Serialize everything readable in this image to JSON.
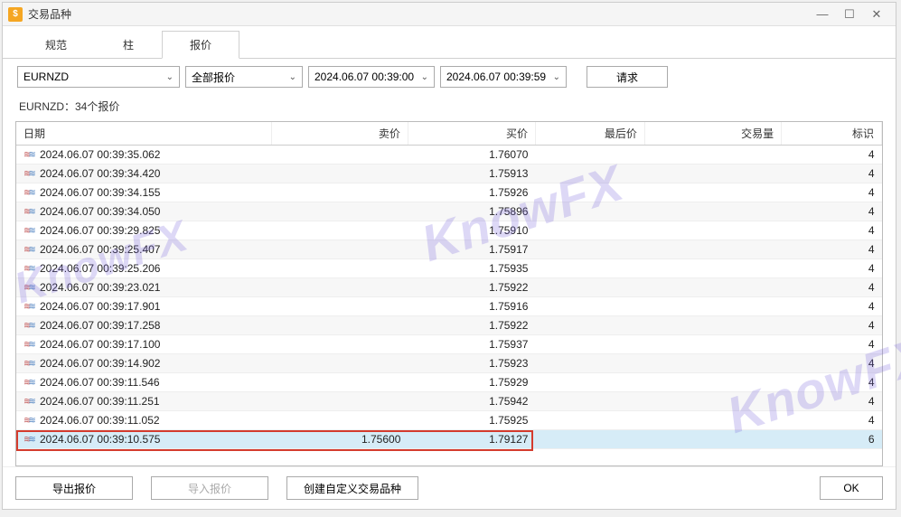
{
  "window": {
    "title": "交易品种",
    "icon_glyph": "$"
  },
  "tabs": [
    {
      "label": "规范",
      "active": false
    },
    {
      "label": "柱",
      "active": false
    },
    {
      "label": "报价",
      "active": true
    }
  ],
  "controls": {
    "symbol": "EURNZD",
    "price_type": "全部报价",
    "from": "2024.06.07 00:39:00",
    "to": "2024.06.07 00:39:59",
    "request_label": "请求"
  },
  "summary": "EURNZD：34个报价",
  "columns": {
    "date": "日期",
    "ask": "卖价",
    "bid": "买价",
    "last": "最后价",
    "volume": "交易量",
    "flag": "标识"
  },
  "rows": [
    {
      "date": "2024.06.07 00:39:35.062",
      "ask": "",
      "bid": "1.76070",
      "last": "",
      "volume": "",
      "flag": "4"
    },
    {
      "date": "2024.06.07 00:39:34.420",
      "ask": "",
      "bid": "1.75913",
      "last": "",
      "volume": "",
      "flag": "4"
    },
    {
      "date": "2024.06.07 00:39:34.155",
      "ask": "",
      "bid": "1.75926",
      "last": "",
      "volume": "",
      "flag": "4"
    },
    {
      "date": "2024.06.07 00:39:34.050",
      "ask": "",
      "bid": "1.75896",
      "last": "",
      "volume": "",
      "flag": "4"
    },
    {
      "date": "2024.06.07 00:39:29.825",
      "ask": "",
      "bid": "1.75910",
      "last": "",
      "volume": "",
      "flag": "4"
    },
    {
      "date": "2024.06.07 00:39:25.407",
      "ask": "",
      "bid": "1.75917",
      "last": "",
      "volume": "",
      "flag": "4"
    },
    {
      "date": "2024.06.07 00:39:25.206",
      "ask": "",
      "bid": "1.75935",
      "last": "",
      "volume": "",
      "flag": "4"
    },
    {
      "date": "2024.06.07 00:39:23.021",
      "ask": "",
      "bid": "1.75922",
      "last": "",
      "volume": "",
      "flag": "4"
    },
    {
      "date": "2024.06.07 00:39:17.901",
      "ask": "",
      "bid": "1.75916",
      "last": "",
      "volume": "",
      "flag": "4"
    },
    {
      "date": "2024.06.07 00:39:17.258",
      "ask": "",
      "bid": "1.75922",
      "last": "",
      "volume": "",
      "flag": "4"
    },
    {
      "date": "2024.06.07 00:39:17.100",
      "ask": "",
      "bid": "1.75937",
      "last": "",
      "volume": "",
      "flag": "4"
    },
    {
      "date": "2024.06.07 00:39:14.902",
      "ask": "",
      "bid": "1.75923",
      "last": "",
      "volume": "",
      "flag": "4"
    },
    {
      "date": "2024.06.07 00:39:11.546",
      "ask": "",
      "bid": "1.75929",
      "last": "",
      "volume": "",
      "flag": "4"
    },
    {
      "date": "2024.06.07 00:39:11.251",
      "ask": "",
      "bid": "1.75942",
      "last": "",
      "volume": "",
      "flag": "4"
    },
    {
      "date": "2024.06.07 00:39:11.052",
      "ask": "",
      "bid": "1.75925",
      "last": "",
      "volume": "",
      "flag": "4"
    },
    {
      "date": "2024.06.07 00:39:10.575",
      "ask": "1.75600",
      "bid": "1.79127",
      "last": "",
      "volume": "",
      "flag": "6",
      "highlight": true
    }
  ],
  "footer": {
    "export_label": "导出报价",
    "import_label": "导入报价",
    "custom_label": "创建自定义交易品种",
    "ok_label": "OK"
  },
  "watermark": "KnowFX"
}
